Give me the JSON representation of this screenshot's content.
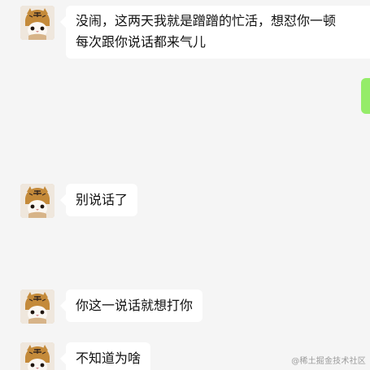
{
  "messages": [
    {
      "text": "没闹，这两天我就是蹭蹭的忙活，想怼你一顿\n每次跟你说话都来气儿"
    },
    {
      "text": "别说话了"
    },
    {
      "text": "你这一说话就想打你"
    },
    {
      "text": "不知道为啥"
    }
  ],
  "watermark": "@稀土掘金技术社区",
  "colors": {
    "background": "#f5f5f5",
    "incoming_bubble": "#ffffff",
    "outgoing_bubble": "#95ec69"
  },
  "icons": {
    "avatar": "cat-wearing-tiger-hat-avatar"
  }
}
